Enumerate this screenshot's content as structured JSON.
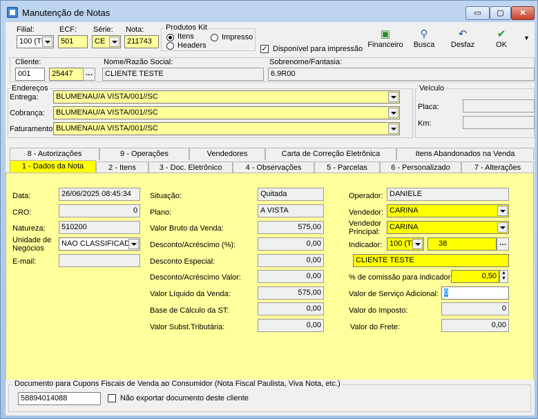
{
  "window": {
    "title": "Manutenção de Notas",
    "min_symbol": "▭",
    "max_symbol": "▢",
    "close_symbol": "✕"
  },
  "header": {
    "filial_label": "Filial:",
    "filial_value": "100 (TI",
    "ecf_label": "ECF:",
    "ecf_value": "501",
    "serie_label": "Série:",
    "serie_value": "CE",
    "nota_label": "Nota:",
    "nota_value": "211743",
    "produtos_kit_label": "Produtos Kit",
    "opt_itens": "Itens",
    "opt_impresso": "Impresso",
    "opt_headers": "Headers",
    "disponivel_label": "Disponível para impressão"
  },
  "toolbar": {
    "financeiro": "Financeiro",
    "busca": "Busca",
    "desfaz": "Desfaz",
    "ok": "OK"
  },
  "cliente": {
    "label": "Cliente:",
    "code1": "001",
    "code2": "25447",
    "razao_label": "Nome/Razão Social:",
    "razao_value": "CLIENTE TESTE",
    "fantasia_label": "Sobrenome/Fantasia:",
    "fantasia_value": "6.9R00"
  },
  "enderecos": {
    "label": "Endereços",
    "entrega_label": "Entrega:",
    "entrega_value": "BLUMENAU/A VISTA/001//SC",
    "cobranca_label": "Cobrança:",
    "cobranca_value": "BLUMENAU/A VISTA/001//SC",
    "faturamento_label": "Faturamento:",
    "faturamento_value": "BLUMENAU/A VISTA/001//SC"
  },
  "veiculo": {
    "label": "Veículo",
    "placa_label": "Placa:",
    "km_label": "Km:"
  },
  "tabs_row1": [
    "8 - Autorizações",
    "9 - Operações",
    "Vendedores",
    "Carta de Correção Eletrônica",
    "Itens Abandonados na Venda"
  ],
  "tabs_row2": [
    "1 - Dados da Nota",
    "2 - Itens",
    "3 - Doc. Eletrônico",
    "4 - Observações",
    "5 - Parcelas",
    "6 - Personalizado",
    "7 - Alterações"
  ],
  "dados": {
    "data_label": "Data:",
    "data_value": "26/06/2025 08:45:34",
    "cro_label": "CRO:",
    "cro_value": "0",
    "natureza_label": "Natureza:",
    "natureza_value": "510200",
    "unidade_label": "Unidade de Negócios",
    "unidade_value": "NAO CLASSIFICADO",
    "email_label": "E-mail:",
    "situacao_label": "Situação:",
    "situacao_value": "Quitada",
    "plano_label": "Plano:",
    "plano_value": "A VISTA",
    "bruto_label": "Valor Bruto da Venda:",
    "bruto_value": "575,00",
    "desc_pct_label": "Desconto/Acréscimo (%):",
    "desc_pct_value": "0,00",
    "desc_esp_label": "Desconto Especial:",
    "desc_esp_value": "0,00",
    "desc_val_label": "Desconto/Acréscimo Valor:",
    "desc_val_value": "0,00",
    "liquido_label": "Valor Líquido da Venda:",
    "liquido_value": "575,00",
    "base_st_label": "Base de Cálculo da ST:",
    "base_st_value": "0,00",
    "subst_label": "Valor Subst.Tributária:",
    "subst_value": "0,00",
    "operador_label": "Operador:",
    "operador_value": "DANIELE",
    "vendedor_label": "Vendedor:",
    "vendedor_value": "CARINA",
    "vend_principal_label": "Vendedor Principal:",
    "vend_principal_value": "CARINA",
    "indicador_label": "Indicador:",
    "indicador_code": "100 (TI",
    "indicador_value": "38",
    "indicador_nome": "CLIENTE TESTE",
    "comissao_label": "% de comissão para indicador:",
    "comissao_value": "0,50",
    "servico_label": "Valor de Serviço Adicional:",
    "servico_value": "0",
    "imposto_label": "Valor do Imposto:",
    "imposto_value": "0",
    "frete_label": "Valor do Frete:",
    "frete_value": "0,00"
  },
  "cupom": {
    "label": "Documento para Cupons Fiscais de Venda ao Consumidor (Nota Fiscal Paulista, Viva Nota, etc.)",
    "value": "58894014088",
    "nao_exportar_label": "Não exportar documento deste cliente"
  }
}
